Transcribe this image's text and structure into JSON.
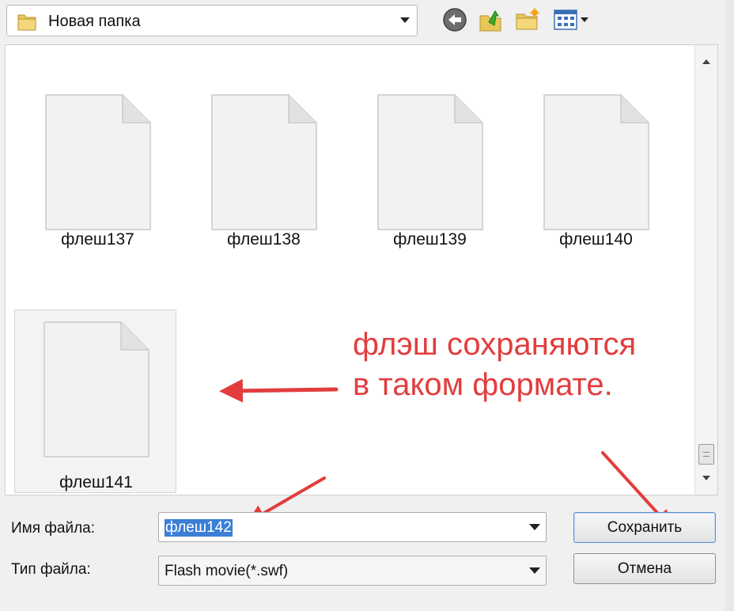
{
  "toolbar": {
    "current_folder": "Новая папка",
    "buttons": [
      {
        "name": "back-button",
        "icon": "back-arrow-icon"
      },
      {
        "name": "up-folder-button",
        "icon": "up-folder-icon"
      },
      {
        "name": "new-folder-button",
        "icon": "new-folder-icon"
      },
      {
        "name": "view-menu-button",
        "icon": "view-grid-icon"
      }
    ]
  },
  "files": [
    {
      "label": "флеш137"
    },
    {
      "label": "флеш138"
    },
    {
      "label": "флеш139"
    },
    {
      "label": "флеш140"
    },
    {
      "label": "флеш141"
    }
  ],
  "annotation": {
    "line1": "флэш сохраняются",
    "line2": "в таком формате.",
    "color": "#e23d3d"
  },
  "form": {
    "filename_label": "Имя файла:",
    "filename_value": "флеш142",
    "filetype_label": "Тип файла:",
    "filetype_value": "Flash movie(*.swf)",
    "save_button": "Сохранить",
    "cancel_button": "Отмена"
  },
  "colors": {
    "selection": "#3b7fd6",
    "arrow": "#e23d3d"
  }
}
